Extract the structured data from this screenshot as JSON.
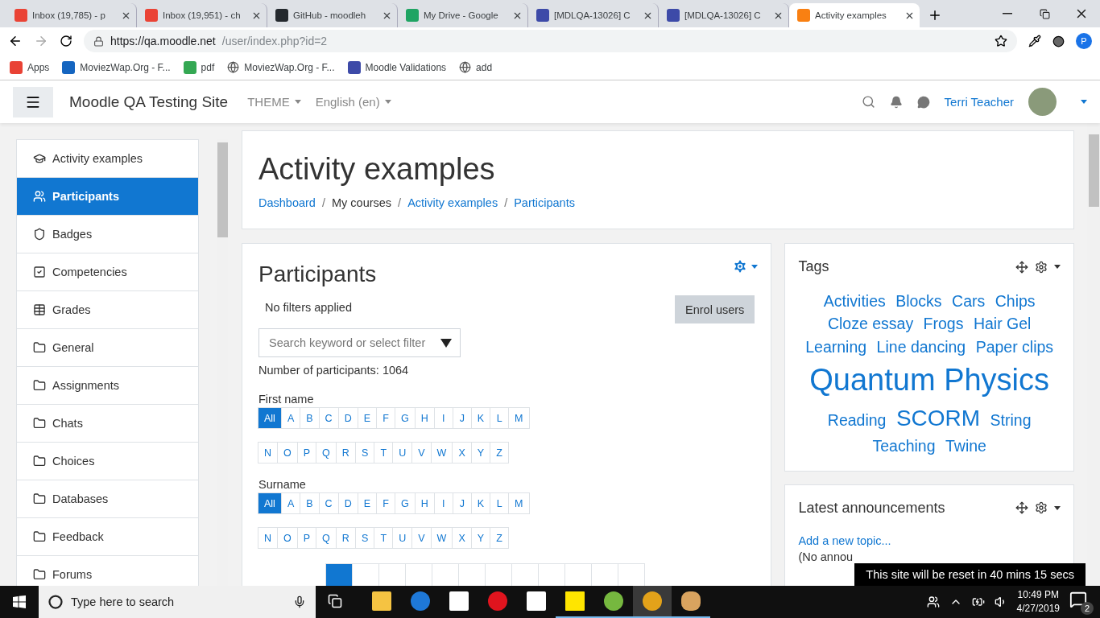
{
  "browser": {
    "tabs": [
      {
        "title": "Inbox (19,785) - p",
        "kind": "gmail",
        "selected": false
      },
      {
        "title": "Inbox (19,951) - ch",
        "kind": "gmail",
        "selected": false
      },
      {
        "title": "GitHub - moodleh",
        "kind": "github",
        "selected": false
      },
      {
        "title": "My Drive - Google",
        "kind": "drive",
        "selected": false
      },
      {
        "title": "[MDLQA-13026] C",
        "kind": "tracker",
        "selected": false
      },
      {
        "title": "[MDLQA-13026] C",
        "kind": "tracker",
        "selected": false
      },
      {
        "title": "Activity examples",
        "kind": "moodle",
        "selected": true
      }
    ],
    "url_host": "https://qa.moodle.net",
    "url_path": "/user/index.php?id=2",
    "profile": "P",
    "bookmarks": [
      {
        "label": "Apps",
        "kind": "apps"
      },
      {
        "label": "MoviezWap.Org - F...",
        "kind": "mw"
      },
      {
        "label": "pdf",
        "kind": "leaf"
      },
      {
        "label": "MoviezWap.Org - F...",
        "kind": "globe"
      },
      {
        "label": "Moodle Validations",
        "kind": "tracker"
      },
      {
        "label": "add",
        "kind": "globe"
      }
    ]
  },
  "navbar": {
    "site_name": "Moodle QA Testing Site",
    "menus": [
      "THEME",
      "English (en)"
    ],
    "user": "Terri Teacher"
  },
  "drawer": {
    "items": [
      {
        "label": "Activity examples",
        "kind": "cap",
        "selected": false
      },
      {
        "label": "Participants",
        "kind": "users",
        "selected": true
      },
      {
        "label": "Badges",
        "kind": "shield",
        "selected": false
      },
      {
        "label": "Competencies",
        "kind": "check",
        "selected": false
      },
      {
        "label": "Grades",
        "kind": "table",
        "selected": false
      },
      {
        "label": "General",
        "kind": "folder",
        "selected": false
      },
      {
        "label": "Assignments",
        "kind": "folder",
        "selected": false
      },
      {
        "label": "Chats",
        "kind": "folder",
        "selected": false
      },
      {
        "label": "Choices",
        "kind": "folder",
        "selected": false
      },
      {
        "label": "Databases",
        "kind": "folder",
        "selected": false
      },
      {
        "label": "Feedback",
        "kind": "folder",
        "selected": false
      },
      {
        "label": "Forums",
        "kind": "folder",
        "selected": false
      }
    ]
  },
  "header": {
    "title": "Activity examples",
    "breadcrumb": [
      {
        "label": "Dashboard",
        "link": true
      },
      {
        "label": "My courses",
        "link": false,
        "separator": "/"
      },
      {
        "label": "Activity examples",
        "link": true,
        "separator": "/"
      },
      {
        "label": "Participants",
        "link": true,
        "separator": "/"
      }
    ]
  },
  "participants": {
    "title": "Participants",
    "filters": "No filters applied",
    "enrol_button": "Enrol users",
    "search": {
      "placeholder": "Search keyword or select filter"
    },
    "count": "Number of participants: 1064",
    "initials": [
      {
        "label": "First name",
        "rows": [
          [
            {
              "text": "All",
              "selected": true
            },
            {
              "text": "A",
              "selected": false
            },
            {
              "text": "B",
              "selected": false
            },
            {
              "text": "C",
              "selected": false
            },
            {
              "text": "D",
              "selected": false
            },
            {
              "text": "E",
              "selected": false
            },
            {
              "text": "F",
              "selected": false
            },
            {
              "text": "G",
              "selected": false
            },
            {
              "text": "H",
              "selected": false
            },
            {
              "text": "I",
              "selected": false
            },
            {
              "text": "J",
              "selected": false
            },
            {
              "text": "K",
              "selected": false
            },
            {
              "text": "L",
              "selected": false
            },
            {
              "text": "M",
              "selected": false
            }
          ],
          [
            {
              "text": "N",
              "selected": false
            },
            {
              "text": "O",
              "selected": false
            },
            {
              "text": "P",
              "selected": false
            },
            {
              "text": "Q",
              "selected": false
            },
            {
              "text": "R",
              "selected": false
            },
            {
              "text": "S",
              "selected": false
            },
            {
              "text": "T",
              "selected": false
            },
            {
              "text": "U",
              "selected": false
            },
            {
              "text": "V",
              "selected": false
            },
            {
              "text": "W",
              "selected": false
            },
            {
              "text": "X",
              "selected": false
            },
            {
              "text": "Y",
              "selected": false
            },
            {
              "text": "Z",
              "selected": false
            }
          ]
        ]
      },
      {
        "label": "Surname",
        "rows": [
          [
            {
              "text": "All",
              "selected": true
            },
            {
              "text": "A",
              "selected": false
            },
            {
              "text": "B",
              "selected": false
            },
            {
              "text": "C",
              "selected": false
            },
            {
              "text": "D",
              "selected": false
            },
            {
              "text": "E",
              "selected": false
            },
            {
              "text": "F",
              "selected": false
            },
            {
              "text": "G",
              "selected": false
            },
            {
              "text": "H",
              "selected": false
            },
            {
              "text": "I",
              "selected": false
            },
            {
              "text": "J",
              "selected": false
            },
            {
              "text": "K",
              "selected": false
            },
            {
              "text": "L",
              "selected": false
            },
            {
              "text": "M",
              "selected": false
            }
          ],
          [
            {
              "text": "N",
              "selected": false
            },
            {
              "text": "O",
              "selected": false
            },
            {
              "text": "P",
              "selected": false
            },
            {
              "text": "Q",
              "selected": false
            },
            {
              "text": "R",
              "selected": false
            },
            {
              "text": "S",
              "selected": false
            },
            {
              "text": "T",
              "selected": false
            },
            {
              "text": "U",
              "selected": false
            },
            {
              "text": "V",
              "selected": false
            },
            {
              "text": "W",
              "selected": false
            },
            {
              "text": "X",
              "selected": false
            },
            {
              "text": "Y",
              "selected": false
            },
            {
              "text": "Z",
              "selected": false
            }
          ]
        ]
      }
    ],
    "pagination": [
      {
        "selected": true
      },
      {
        "selected": false
      },
      {
        "selected": false
      },
      {
        "selected": false
      },
      {
        "selected": false
      },
      {
        "selected": false
      },
      {
        "selected": false
      },
      {
        "selected": false
      },
      {
        "selected": false
      },
      {
        "selected": false
      },
      {
        "selected": false
      },
      {
        "selected": false
      }
    ]
  },
  "tags_block": {
    "title": "Tags",
    "tags": [
      {
        "label": "Activities",
        "kind": "normal"
      },
      {
        "label": "Blocks",
        "kind": "normal"
      },
      {
        "label": "Cars",
        "kind": "normal"
      },
      {
        "label": "Chips",
        "kind": "normal"
      },
      {
        "label": "Cloze essay",
        "kind": "normal"
      },
      {
        "label": "Frogs",
        "kind": "normal"
      },
      {
        "label": "Hair Gel",
        "kind": "normal"
      },
      {
        "label": "Learning",
        "kind": "normal"
      },
      {
        "label": "Line dancing",
        "kind": "normal"
      },
      {
        "label": "Paper clips",
        "kind": "normal"
      },
      {
        "label": "Quantum Physics",
        "kind": "huge"
      },
      {
        "label": "Reading",
        "kind": "normal"
      },
      {
        "label": "SCORM",
        "kind": "large"
      },
      {
        "label": "String",
        "kind": "normal"
      },
      {
        "label": "Teaching",
        "kind": "normal"
      },
      {
        "label": "Twine",
        "kind": "normal"
      }
    ]
  },
  "announcements_block": {
    "title": "Latest announcements",
    "add_link": "Add a new topic...",
    "empty_text": "(No annou"
  },
  "reset_notice": "This site will be reset in 40 mins 15 secs",
  "taskbar": {
    "search": {
      "placeholder": "Type here to search"
    },
    "apps": [
      {
        "kind": "explorer",
        "running": false,
        "selected": false
      },
      {
        "kind": "edge",
        "running": false,
        "selected": false
      },
      {
        "kind": "store",
        "running": false,
        "selected": false
      },
      {
        "kind": "opera",
        "running": false,
        "selected": false
      },
      {
        "kind": "mail",
        "running": false,
        "selected": false
      },
      {
        "kind": "sticky",
        "running": true,
        "selected": false
      },
      {
        "kind": "torrent",
        "running": true,
        "selected": false
      },
      {
        "kind": "chrome",
        "running": true,
        "selected": true
      },
      {
        "kind": "paint",
        "running": true,
        "selected": false
      }
    ],
    "time": "10:49 PM",
    "date": "4/27/2019",
    "notifications": "2"
  }
}
